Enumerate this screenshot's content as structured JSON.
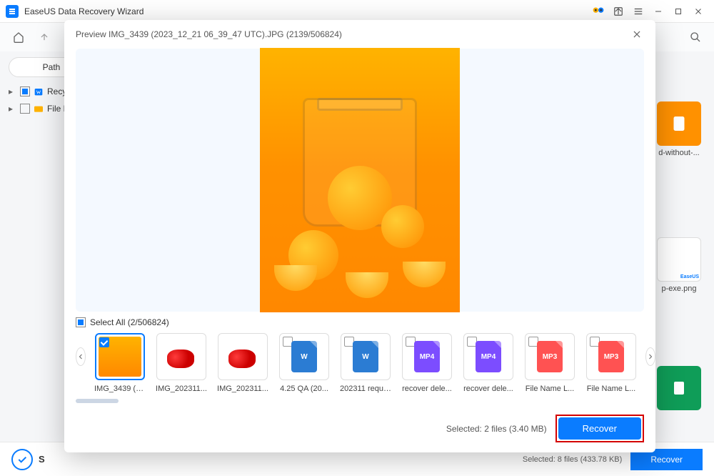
{
  "app": {
    "title": "EaseUS Data Recovery Wizard"
  },
  "sidebar": {
    "path_label": "Path",
    "tree": [
      {
        "label": "Recy..."
      },
      {
        "label": "File P..."
      }
    ]
  },
  "bg_thumbs": [
    {
      "label": "d-without-..."
    },
    {
      "label": "p-exe.png"
    }
  ],
  "modal": {
    "title": "Preview IMG_3439 (2023_12_21 06_39_47 UTC).JPG (2139/506824)",
    "select_all": "Select All (2/506824)",
    "thumbs": [
      {
        "label": "IMG_3439 (2...",
        "type": "orange",
        "selected": true
      },
      {
        "label": "IMG_202311...",
        "type": "tomato",
        "selected": false
      },
      {
        "label": "IMG_202311...",
        "type": "tomato",
        "selected": false
      },
      {
        "label": "4.25 QA (20...",
        "type": "w",
        "selected": false
      },
      {
        "label": "202311 requi...",
        "type": "w",
        "selected": false
      },
      {
        "label": "recover dele...",
        "type": "mp4",
        "selected": false
      },
      {
        "label": "recover dele...",
        "type": "mp4",
        "selected": false
      },
      {
        "label": "File Name L...",
        "type": "mp3",
        "selected": false
      },
      {
        "label": "File Name L...",
        "type": "mp3",
        "selected": false
      }
    ],
    "status": "Selected: 2 files (3.40 MB)",
    "recover": "Recover"
  },
  "bottombar": {
    "status": "Selected: 8 files (433.78 KB)",
    "recover": "Recover"
  },
  "icon_text": {
    "w": "W",
    "mp4": "MP4",
    "mp3": "MP3"
  }
}
